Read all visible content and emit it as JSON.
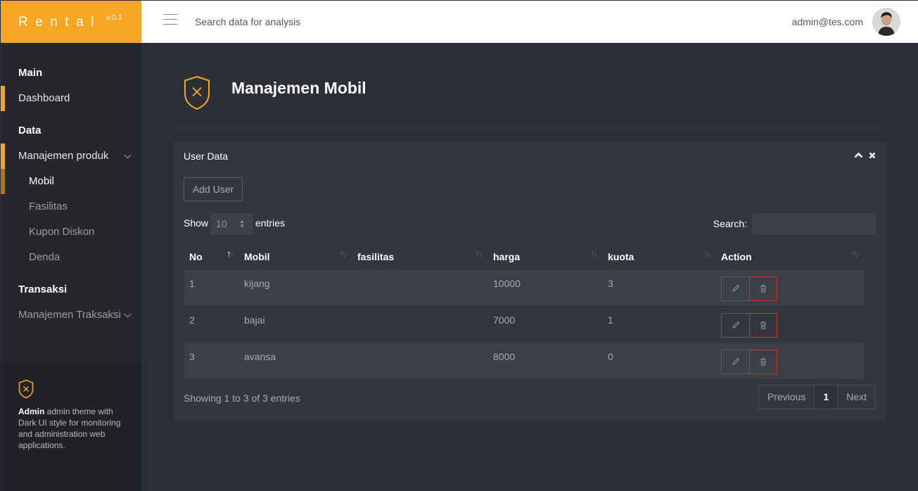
{
  "brand": {
    "name": "Rental",
    "version": "v.0.1"
  },
  "topbar": {
    "search_placeholder": "Search data for analysis",
    "user_email": "admin@tes.com"
  },
  "sidebar": {
    "sections": [
      {
        "label": "Main"
      },
      {
        "label": "Data"
      },
      {
        "label": "Transaksi"
      }
    ],
    "items": {
      "dashboard": "Dashboard",
      "manajemen_produk": "Manajemen produk",
      "mobil": "Mobil",
      "fasilitas": "Fasilitas",
      "kupon": "Kupon Diskon",
      "denda": "Denda",
      "manajemen_transaksi": "Manajemen Traksaksi"
    },
    "footer": {
      "bold": "Admin",
      "text": " admin theme with Dark UI style for monitoring and administration web applications."
    }
  },
  "page": {
    "title": "Manajemen Mobil"
  },
  "panel": {
    "title": "User Data",
    "add_button": "Add User",
    "show_label": "Show",
    "entries_value": "10",
    "entries_label": "entries",
    "search_label": "Search:",
    "columns": [
      "No",
      "Mobil",
      "fasilitas",
      "harga",
      "kuota",
      "Action"
    ],
    "rows": [
      {
        "no": "1",
        "mobil": "kijang",
        "fasilitas": "",
        "harga": "10000",
        "kuota": "3"
      },
      {
        "no": "2",
        "mobil": "bajai",
        "fasilitas": "",
        "harga": "7000",
        "kuota": "1"
      },
      {
        "no": "3",
        "mobil": "avansa",
        "fasilitas": "",
        "harga": "8000",
        "kuota": "0"
      }
    ],
    "info": "Showing 1 to 3 of 3 entries",
    "pager": {
      "previous": "Previous",
      "current": "1",
      "next": "Next"
    }
  },
  "colors": {
    "accent": "#f6a623",
    "background": "#2d2f36",
    "sidebar": "#25272d",
    "panel": "#34363d",
    "danger": "#c0392b"
  }
}
